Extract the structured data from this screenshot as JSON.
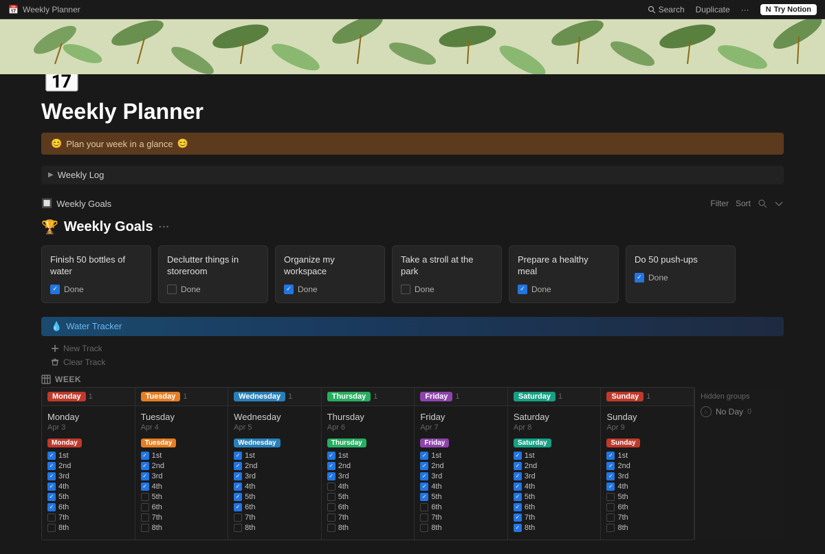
{
  "topbar": {
    "title": "Weekly Planner",
    "favicon": "📅",
    "search_label": "Search",
    "duplicate_label": "Duplicate",
    "more_label": "···",
    "try_notion_label": "Try Notion"
  },
  "page": {
    "icon": "📅",
    "title": "Weekly Planner",
    "callout": {
      "icon_left": "😊",
      "text": "Plan your week in a glance",
      "icon_right": "😊"
    }
  },
  "weekly_log": {
    "label": "Weekly Log"
  },
  "weekly_goals_section": {
    "icon": "🔲",
    "label": "Weekly Goals",
    "filter_label": "Filter",
    "sort_label": "Sort"
  },
  "weekly_goals": {
    "title": "Weekly Goals",
    "title_icon": "🏆",
    "cards": [
      {
        "title": "Finish 50 bottles of water",
        "checked": true,
        "status": "Done"
      },
      {
        "title": "Declutter things in storeroom",
        "checked": false,
        "status": "Done"
      },
      {
        "title": "Organize my workspace",
        "checked": true,
        "status": "Done"
      },
      {
        "title": "Take a stroll at the park",
        "checked": false,
        "status": "Done"
      },
      {
        "title": "Prepare a healthy meal",
        "checked": true,
        "status": "Done"
      },
      {
        "title": "Do 50 push-ups",
        "checked": true,
        "status": "Done"
      }
    ]
  },
  "water_tracker": {
    "icon": "💧",
    "label": "Water Tracker",
    "new_track_label": "New Track",
    "clear_track_label": "Clear Track"
  },
  "week_view": {
    "label": "WEEK",
    "days": [
      {
        "tag": "Monday",
        "tag_class": "monday-tag",
        "badge_class": "monday-badge",
        "count": "1",
        "name": "Monday",
        "date": "Apr 3",
        "items": [
          {
            "label": "1st",
            "checked": true
          },
          {
            "label": "2nd",
            "checked": true
          },
          {
            "label": "3rd",
            "checked": true
          },
          {
            "label": "4th",
            "checked": true
          },
          {
            "label": "5th",
            "checked": true
          },
          {
            "label": "6th",
            "checked": true
          },
          {
            "label": "7th",
            "checked": false
          },
          {
            "label": "8th",
            "checked": false
          }
        ]
      },
      {
        "tag": "Tuesday",
        "tag_class": "tuesday-tag",
        "badge_class": "tuesday-badge",
        "count": "1",
        "name": "Tuesday",
        "date": "Apr 4",
        "items": [
          {
            "label": "1st",
            "checked": true
          },
          {
            "label": "2nd",
            "checked": true
          },
          {
            "label": "3rd",
            "checked": true
          },
          {
            "label": "4th",
            "checked": true
          },
          {
            "label": "5th",
            "checked": false
          },
          {
            "label": "6th",
            "checked": false
          },
          {
            "label": "7th",
            "checked": false
          },
          {
            "label": "8th",
            "checked": false
          }
        ]
      },
      {
        "tag": "Wednesday",
        "tag_class": "wednesday-tag",
        "badge_class": "wednesday-badge",
        "count": "1",
        "name": "Wednesday",
        "date": "Apr 5",
        "items": [
          {
            "label": "1st",
            "checked": true
          },
          {
            "label": "2nd",
            "checked": true
          },
          {
            "label": "3rd",
            "checked": true
          },
          {
            "label": "4th",
            "checked": true
          },
          {
            "label": "5th",
            "checked": true
          },
          {
            "label": "6th",
            "checked": true
          },
          {
            "label": "7th",
            "checked": false
          },
          {
            "label": "8th",
            "checked": false
          }
        ]
      },
      {
        "tag": "Thursday",
        "tag_class": "thursday-tag",
        "badge_class": "thursday-badge",
        "count": "1",
        "name": "Thursday",
        "date": "Apr 6",
        "items": [
          {
            "label": "1st",
            "checked": true
          },
          {
            "label": "2nd",
            "checked": true
          },
          {
            "label": "3rd",
            "checked": true
          },
          {
            "label": "4th",
            "checked": false
          },
          {
            "label": "5th",
            "checked": false
          },
          {
            "label": "6th",
            "checked": false
          },
          {
            "label": "7th",
            "checked": false
          },
          {
            "label": "8th",
            "checked": false
          }
        ]
      },
      {
        "tag": "Friday",
        "tag_class": "friday-tag",
        "badge_class": "friday-badge",
        "count": "1",
        "name": "Friday",
        "date": "Apr 7",
        "items": [
          {
            "label": "1st",
            "checked": true
          },
          {
            "label": "2nd",
            "checked": true
          },
          {
            "label": "3rd",
            "checked": true
          },
          {
            "label": "4th",
            "checked": true
          },
          {
            "label": "5th",
            "checked": true
          },
          {
            "label": "6th",
            "checked": false
          },
          {
            "label": "7th",
            "checked": false
          },
          {
            "label": "8th",
            "checked": false
          }
        ]
      },
      {
        "tag": "Saturday",
        "tag_class": "saturday-tag",
        "badge_class": "saturday-badge",
        "count": "1",
        "name": "Saturday",
        "date": "Apr 8",
        "items": [
          {
            "label": "1st",
            "checked": true
          },
          {
            "label": "2nd",
            "checked": true
          },
          {
            "label": "3rd",
            "checked": true
          },
          {
            "label": "4th",
            "checked": true
          },
          {
            "label": "5th",
            "checked": true
          },
          {
            "label": "6th",
            "checked": true
          },
          {
            "label": "7th",
            "checked": true
          },
          {
            "label": "8th",
            "checked": true
          }
        ]
      },
      {
        "tag": "Sunday",
        "tag_class": "sunday-tag",
        "badge_class": "sunday-badge",
        "count": "1",
        "name": "Sunday",
        "date": "Apr 9",
        "items": [
          {
            "label": "1st",
            "checked": true
          },
          {
            "label": "2nd",
            "checked": true
          },
          {
            "label": "3rd",
            "checked": true
          },
          {
            "label": "4th",
            "checked": true
          },
          {
            "label": "5th",
            "checked": false
          },
          {
            "label": "6th",
            "checked": false
          },
          {
            "label": "7th",
            "checked": false
          },
          {
            "label": "8th",
            "checked": false
          }
        ]
      }
    ],
    "hidden_groups_label": "Hidden groups",
    "no_day_label": "No Day",
    "no_day_count": "0"
  }
}
